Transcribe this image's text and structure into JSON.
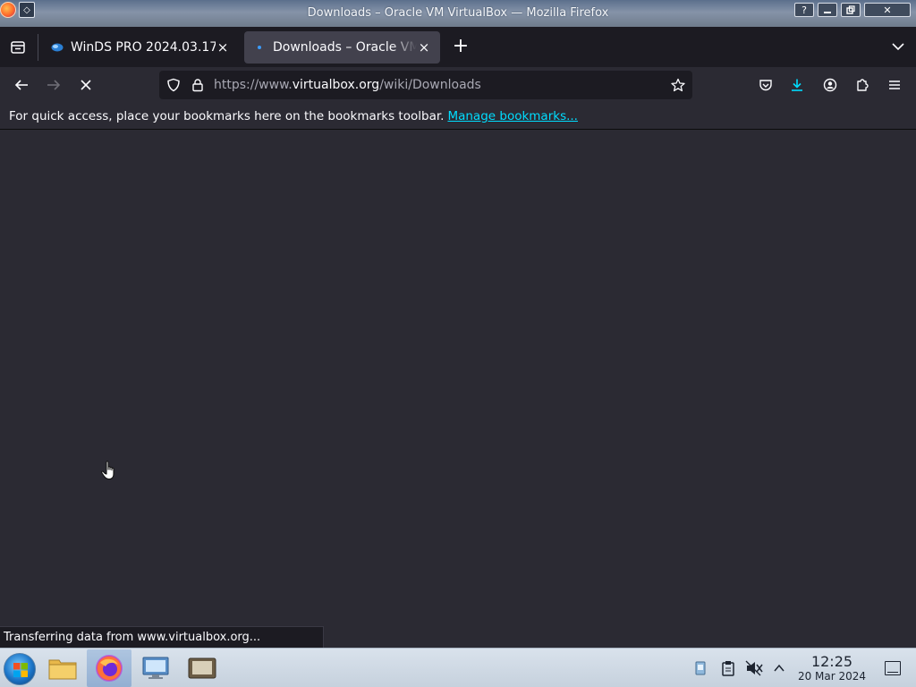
{
  "window": {
    "title": "Downloads – Oracle VM VirtualBox — Mozilla Firefox",
    "help_glyph": "?",
    "close_glyph": "✕"
  },
  "tabs": [
    {
      "label": "WinDS PRO 2024.03.17",
      "active": false,
      "favicon": "winds-icon",
      "close_glyph": "×"
    },
    {
      "label": "Downloads – Oracle VM VirtualBox",
      "active": true,
      "favicon": "loading-dot-icon",
      "close_glyph": "×"
    }
  ],
  "newtab_glyph": "+",
  "urlbar": {
    "prefix": "https://www.",
    "host": "virtualbox.org",
    "path": "/wiki/Downloads"
  },
  "bookmarks_bar": {
    "message": "For quick access, place your bookmarks here on the bookmarks toolbar.",
    "link_label": "Manage bookmarks..."
  },
  "status_text": "Transferring data from www.virtualbox.org...",
  "taskbar": {
    "apps": [
      "file-manager-icon",
      "firefox-icon",
      "control-panel-icon",
      "virtualbox-icon"
    ],
    "time": "12:25",
    "date": "20 Mar 2024"
  },
  "colors": {
    "accent": "#00ddff",
    "toolbar": "#2b2a33",
    "tabstrip": "#1c1b22",
    "active_tab": "#42414d"
  }
}
